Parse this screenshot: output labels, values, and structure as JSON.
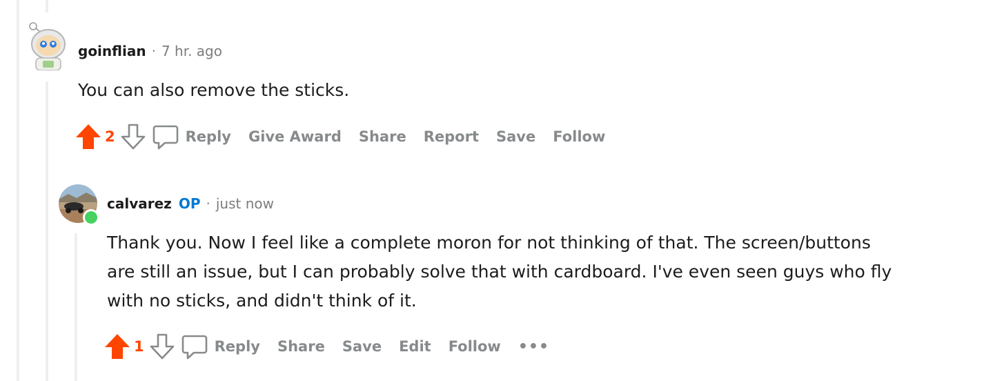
{
  "comments": [
    {
      "author": "goinflian",
      "separator": "·",
      "time": "7 hr. ago",
      "body": "You can also remove the sticks.",
      "score": "2",
      "actions": {
        "reply": "Reply",
        "give_award": "Give Award",
        "share": "Share",
        "report": "Report",
        "save": "Save",
        "follow": "Follow"
      }
    },
    {
      "author": "calvarez",
      "badge": "OP",
      "separator": "·",
      "time": "just now",
      "body_lines": [
        "Thank you. Now I feel like a complete moron for not thinking of that. The screen/buttons",
        "are still an issue, but I can probably solve that with cardboard. I've even seen guys who fly",
        "with no sticks, and didn't think of it."
      ],
      "score": "1",
      "actions": {
        "reply": "Reply",
        "share": "Share",
        "save": "Save",
        "edit": "Edit",
        "follow": "Follow",
        "more": "•••"
      }
    }
  ],
  "colors": {
    "upvote": "#ff4500",
    "op_badge": "#0079d3",
    "online": "#46d160",
    "action_gray": "#878a8c"
  }
}
